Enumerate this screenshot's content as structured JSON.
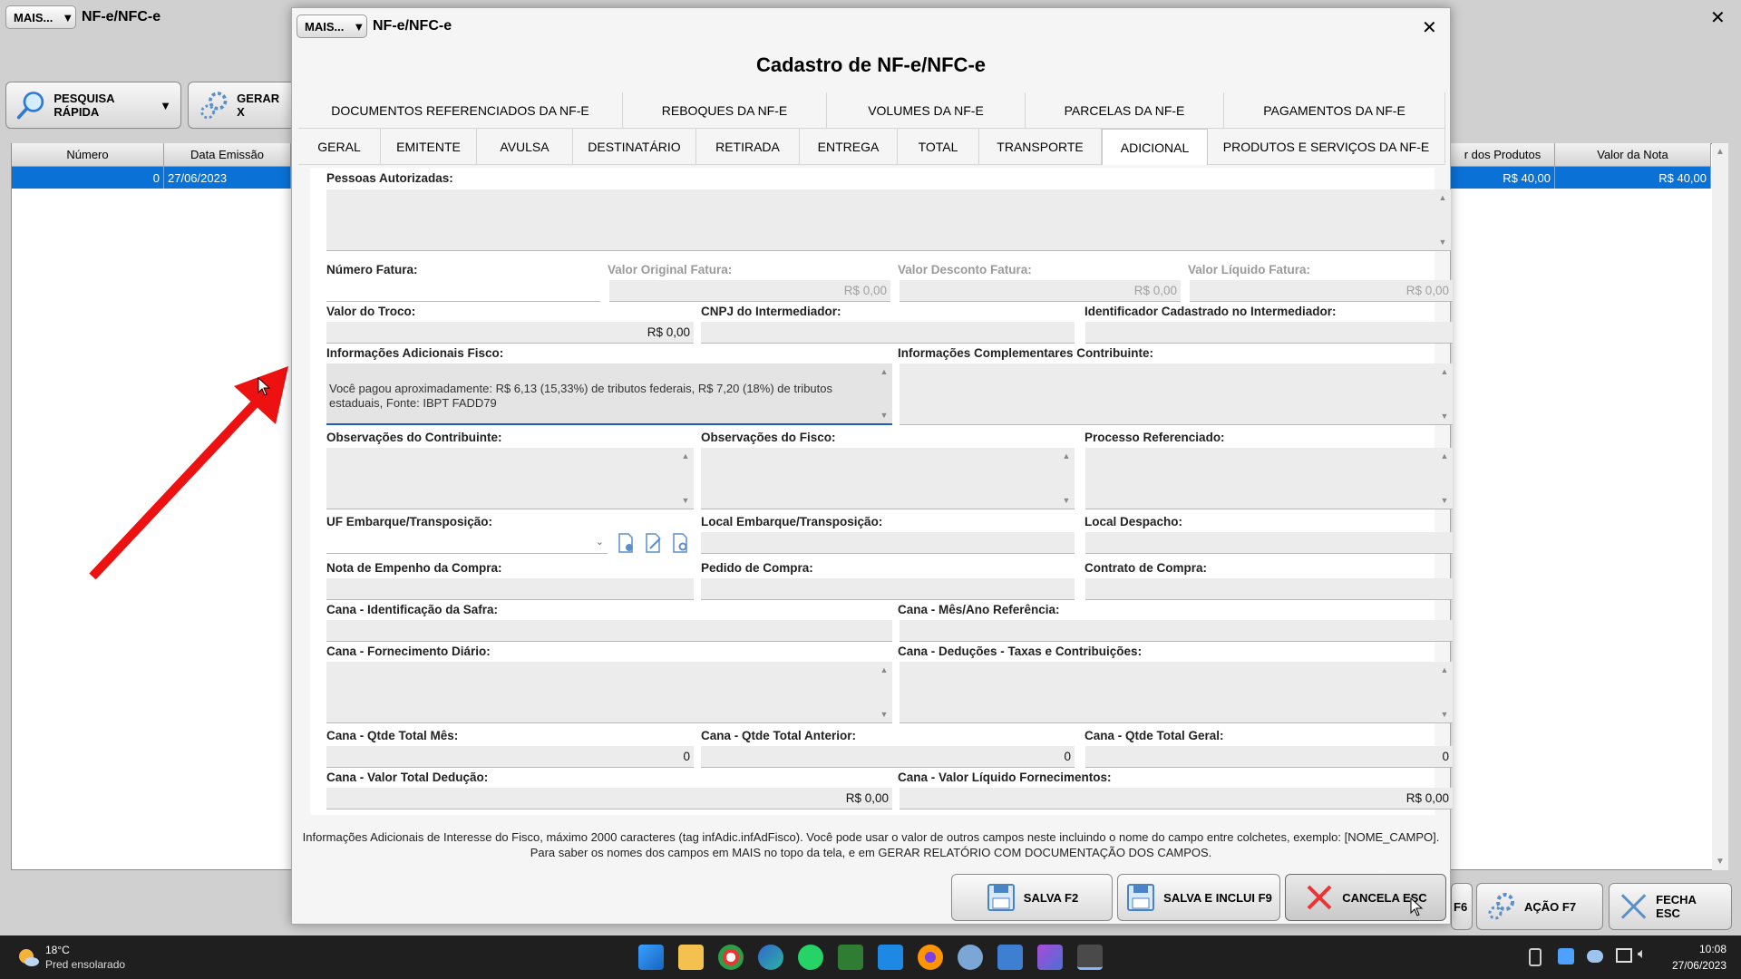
{
  "background_window": {
    "mais_label": "MAIS...",
    "title": "NF-e/NFC-e",
    "pesquisa_label": "PESQUISA RÁPIDA",
    "gerar_label": "GERAR X",
    "columns": [
      "Número",
      "Data Emissão",
      "r dos Produtos",
      "Valor da Nota"
    ],
    "row": {
      "numero": "0",
      "data": "27/06/2023",
      "valor_produtos": "R$ 40,00",
      "valor_nota": "R$ 40,00"
    },
    "partial_f6": "F6",
    "acao_label": "AÇÃO F7",
    "fecha_label": "FECHA ESC"
  },
  "dialog": {
    "mais_label": "MAIS...",
    "title": "NF-e/NFC-e",
    "heading": "Cadastro de NF-e/NFC-e",
    "tabs_top": [
      "DOCUMENTOS REFERENCIADOS DA NF-E",
      "REBOQUES DA NF-E",
      "VOLUMES DA NF-E",
      "PARCELAS DA NF-E",
      "PAGAMENTOS DA NF-E"
    ],
    "tabs_bottom": [
      "GERAL",
      "EMITENTE",
      "AVULSA",
      "DESTINATÁRIO",
      "RETIRADA",
      "ENTREGA",
      "TOTAL",
      "TRANSPORTE",
      "ADICIONAL",
      "PRODUTOS E SERVIÇOS DA NF-E"
    ],
    "active_tab": "ADICIONAL",
    "fields": {
      "pessoas_autorizadas": "Pessoas Autorizadas:",
      "numero_fatura": "Número Fatura:",
      "valor_original_fatura": "Valor Original Fatura:",
      "valor_original_fatura_value": "R$ 0,00",
      "valor_desconto_fatura": "Valor Desconto Fatura:",
      "valor_desconto_fatura_value": "R$ 0,00",
      "valor_liquido_fatura": "Valor Líquido Fatura:",
      "valor_liquido_fatura_value": "R$ 0,00",
      "valor_troco": "Valor do Troco:",
      "valor_troco_value": "R$ 0,00",
      "cnpj_intermediador": "CNPJ do Intermediador:",
      "identificador_intermediador": "Identificador Cadastrado no Intermediador:",
      "info_adicionais_fisco": "Informações Adicionais Fisco:",
      "info_adicionais_fisco_value": "Você pagou aproximadamente: R$ 6,13 (15,33%) de tributos federais, R$ 7,20 (18%) de tributos estaduais, Fonte: IBPT FADD79",
      "info_complementares": "Informações Complementares Contribuinte:",
      "obs_contribuinte": "Observações do Contribuinte:",
      "obs_fisco": "Observações do Fisco:",
      "processo_referenciado": "Processo Referenciado:",
      "uf_embarque": "UF Embarque/Transposição:",
      "local_embarque": "Local Embarque/Transposição:",
      "local_despacho": "Local Despacho:",
      "nota_empenho": "Nota de Empenho da Compra:",
      "pedido_compra": "Pedido de Compra:",
      "contrato_compra": "Contrato de Compra:",
      "cana_safra": "Cana - Identificação da Safra:",
      "cana_mes_ano": "Cana - Mês/Ano Referência:",
      "cana_fornecimento": "Cana - Fornecimento Diário:",
      "cana_deducoes": "Cana - Deduções - Taxas e Contribuições:",
      "cana_qtde_mes": "Cana - Qtde Total Mês:",
      "cana_qtde_mes_value": "0",
      "cana_qtde_anterior": "Cana - Qtde Total Anterior:",
      "cana_qtde_anterior_value": "0",
      "cana_qtde_geral": "Cana - Qtde Total Geral:",
      "cana_qtde_geral_value": "0",
      "cana_valor_deducao": "Cana - Valor Total Dedução:",
      "cana_valor_deducao_value": "R$ 0,00",
      "cana_valor_liquido": "Cana - Valor Líquido Fornecimentos:",
      "cana_valor_liquido_value": "R$ 0,00"
    },
    "help_line1": "Informações Adicionais de Interesse do Fisco, máximo 2000 caracteres (tag infAdic.infAdFisco). Você pode usar o valor de outros campos neste incluindo o nome do campo entre colchetes, exemplo: [NOME_CAMPO].",
    "help_line2": "Para saber os nomes dos campos em MAIS no topo da tela, e em GERAR RELATÓRIO COM DOCUMENTAÇÃO DOS CAMPOS.",
    "buttons": {
      "salva": "SALVA F2",
      "salva_inclui": "SALVA E INCLUI F9",
      "cancela": "CANCELA ESC"
    }
  },
  "taskbar": {
    "weather_temp": "18°C",
    "weather_desc": "Pred ensolarado",
    "time": "10:08",
    "date": "27/06/2023"
  },
  "colors": {
    "selection": "#0a72d6",
    "arrow": "#ee1111",
    "focus": "#1f5fb8"
  }
}
